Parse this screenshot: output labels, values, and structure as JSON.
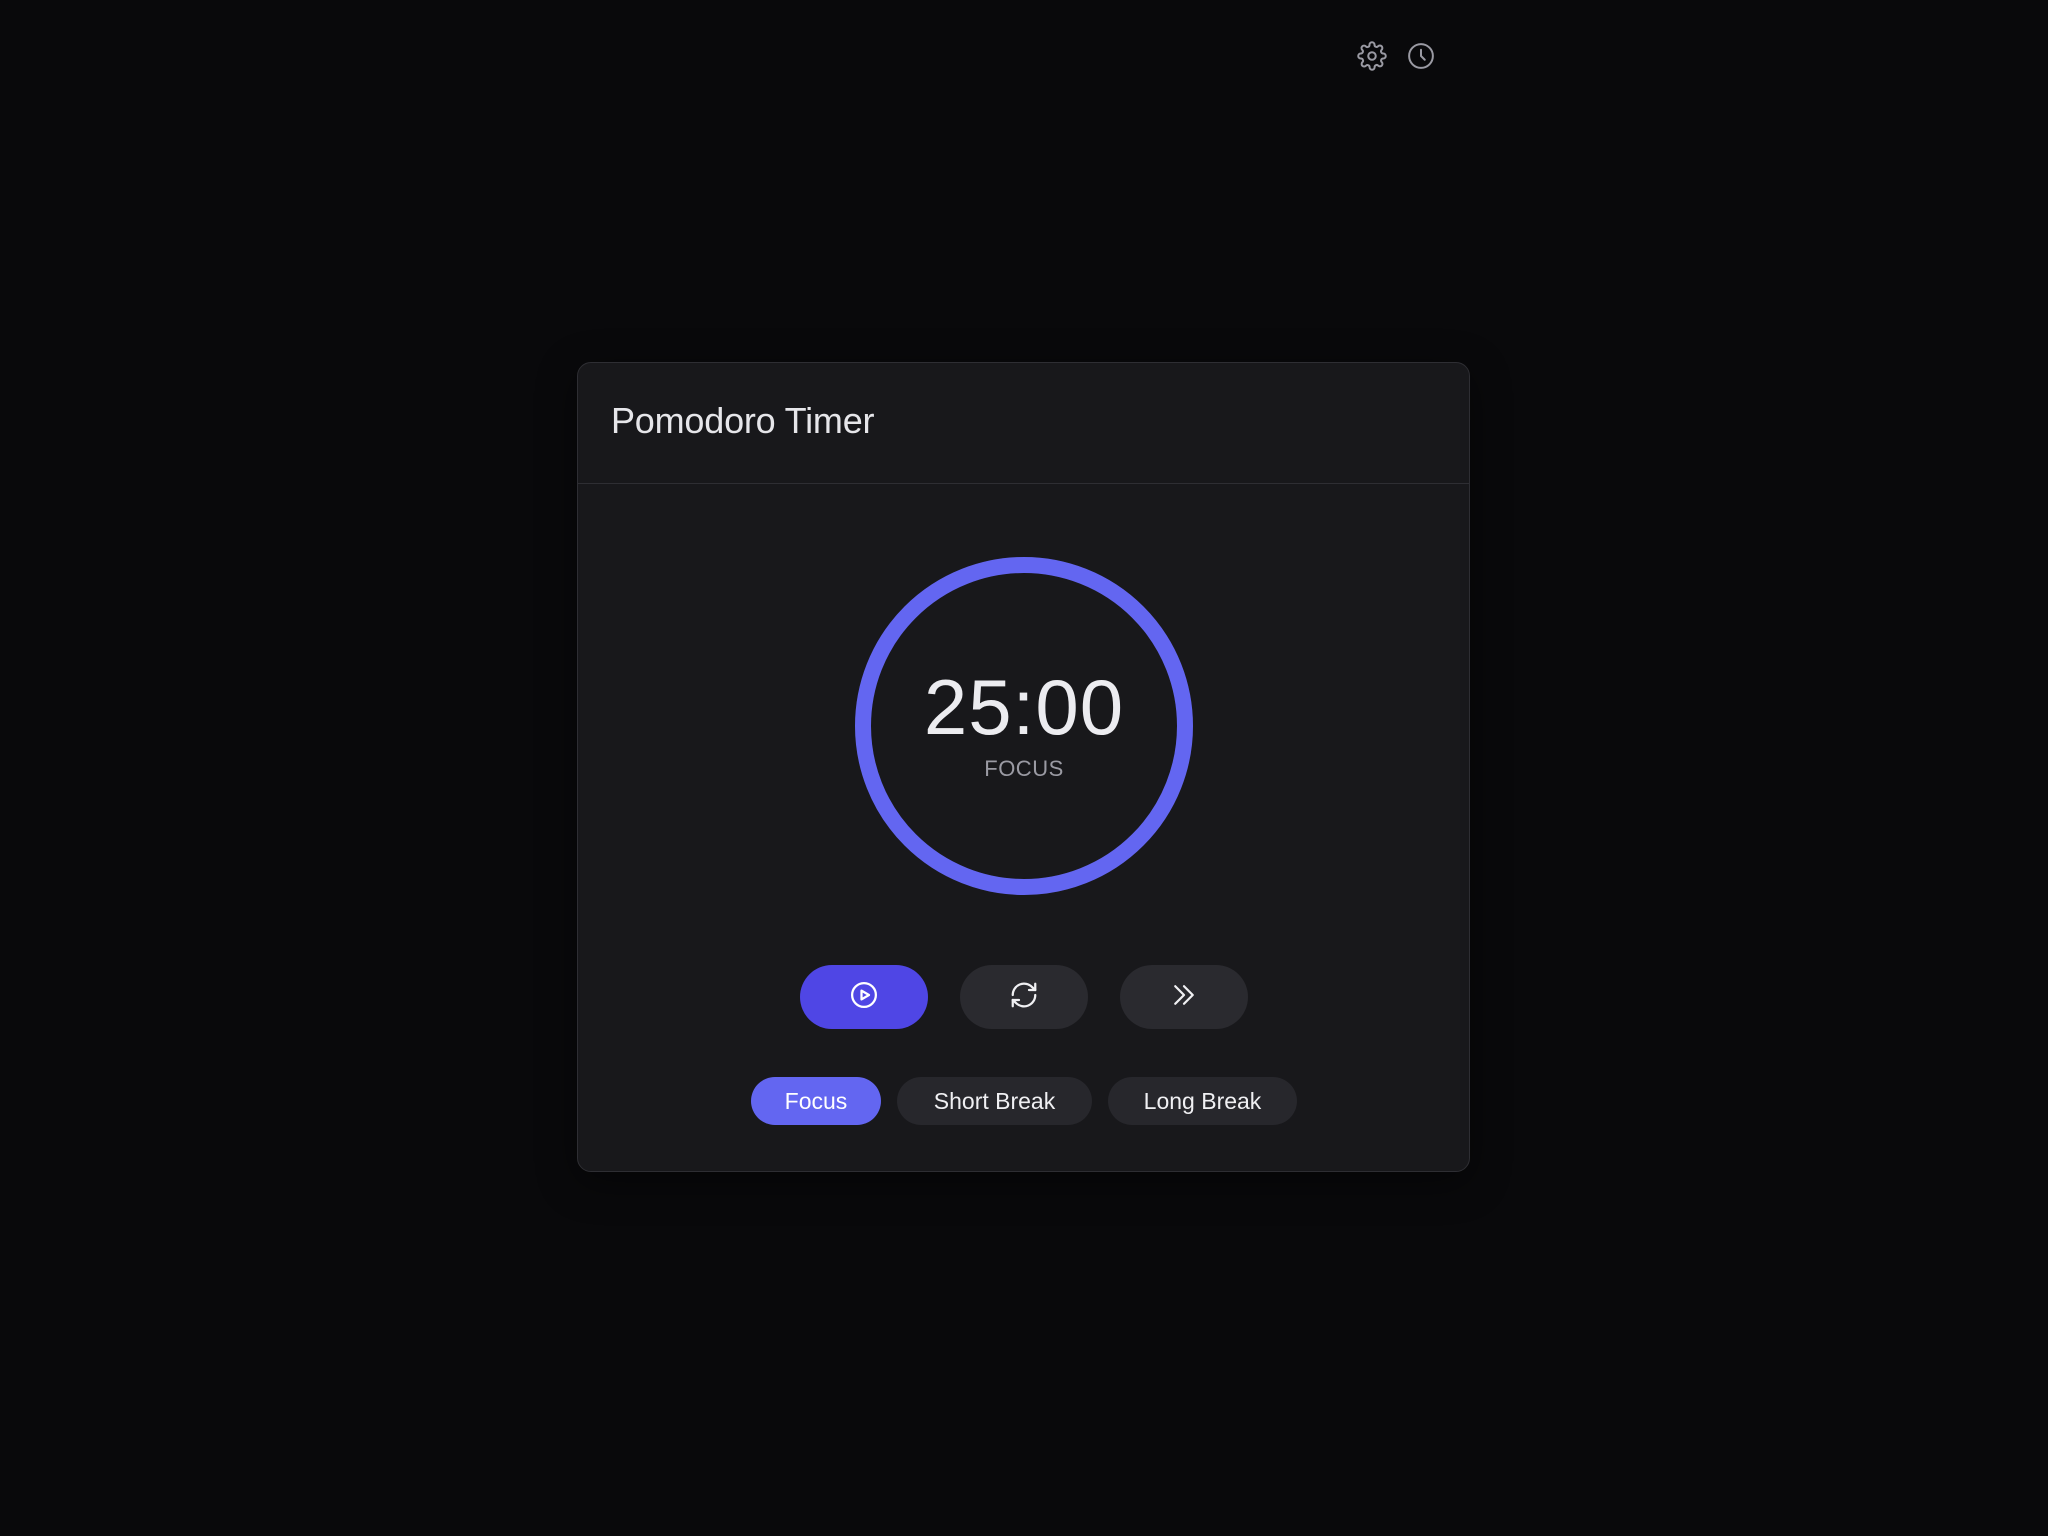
{
  "app": {
    "title": "Pomodoro Timer",
    "icons": {
      "settings": "gear-icon",
      "history": "clock-icon"
    }
  },
  "timer": {
    "time": "25:00",
    "mode": "FOCUS",
    "progress": 1.0,
    "ring_color": "#6366f1"
  },
  "controls": {
    "play": {
      "icon": "play-circle-icon",
      "color": "#4f46e5"
    },
    "reset": {
      "icon": "refresh-icon"
    },
    "skip": {
      "icon": "chevrons-right-icon"
    }
  },
  "modes": [
    {
      "label": "Focus",
      "active": true
    },
    {
      "label": "Short Break",
      "active": false
    },
    {
      "label": "Long Break",
      "active": false
    }
  ],
  "colors": {
    "background": "#09090b",
    "card": "#18181b",
    "accent": "#6366f1"
  }
}
